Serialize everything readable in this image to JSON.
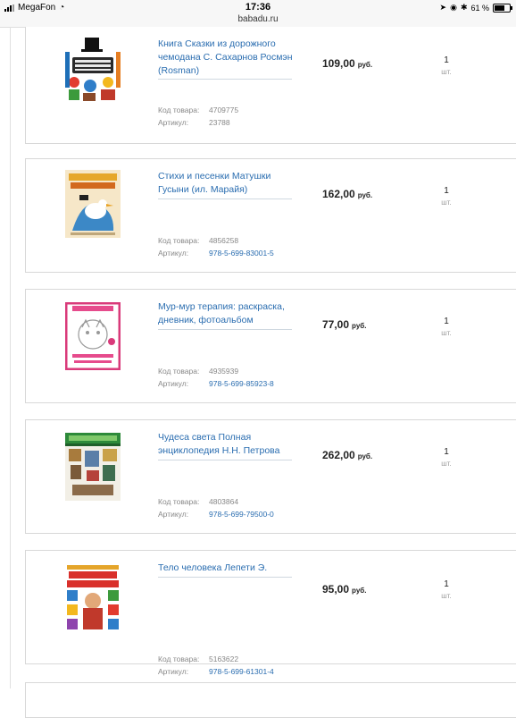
{
  "status_bar": {
    "carrier": "MegaFon",
    "time": "17:36",
    "url": "babadu.ru",
    "battery": "61 %"
  },
  "labels": {
    "code": "Код товара:",
    "article": "Артикул:",
    "currency": "руб.",
    "unit": "шт."
  },
  "items": [
    {
      "title": "Книга Сказки из дорожного чемодана С. Сахарнов Росмэн (Rosman)",
      "code": "4709775",
      "article": "23788",
      "price": "109,00",
      "qty": "1"
    },
    {
      "title": "Стихи и песенки Матушки Гусыни (ил. Марайя)",
      "code": "4856258",
      "article": "978-5-699-83001-5",
      "price": "162,00",
      "qty": "1"
    },
    {
      "title": "Мур-мур терапия: раскраска, дневник, фотоальбом",
      "code": "4935939",
      "article": "978-5-699-85923-8",
      "price": "77,00",
      "qty": "1"
    },
    {
      "title": "Чудеса света Полная энциклопедия Н.Н. Петрова",
      "code": "4803864",
      "article": "978-5-699-79500-0",
      "price": "262,00",
      "qty": "1"
    },
    {
      "title": "Тело человека Лепети Э.",
      "code": "5163622",
      "article": "978-5-699-61301-4",
      "price": "95,00",
      "qty": "1"
    }
  ]
}
